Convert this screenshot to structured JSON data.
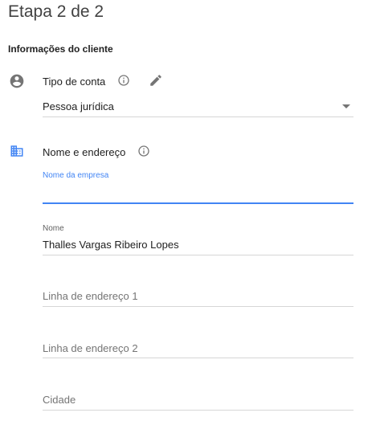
{
  "header": {
    "step_title": "Etapa 2 de 2"
  },
  "section": {
    "title": "Informações do cliente"
  },
  "account_type": {
    "label": "Tipo de conta",
    "value": "Pessoa jurídica"
  },
  "name_address": {
    "label": "Nome e endereço",
    "fields": {
      "company_name": {
        "label": "Nome da empresa",
        "value": ""
      },
      "name": {
        "label": "Nome",
        "value": "Thalles Vargas Ribeiro Lopes"
      },
      "address_1": {
        "placeholder": "Linha de endereço 1"
      },
      "address_2": {
        "placeholder": "Linha de endereço 2"
      },
      "city": {
        "placeholder": "Cidade"
      }
    }
  },
  "colors": {
    "accent": "#4285f4",
    "icon_grey": "#757575",
    "divider": "#d6d6d6"
  }
}
